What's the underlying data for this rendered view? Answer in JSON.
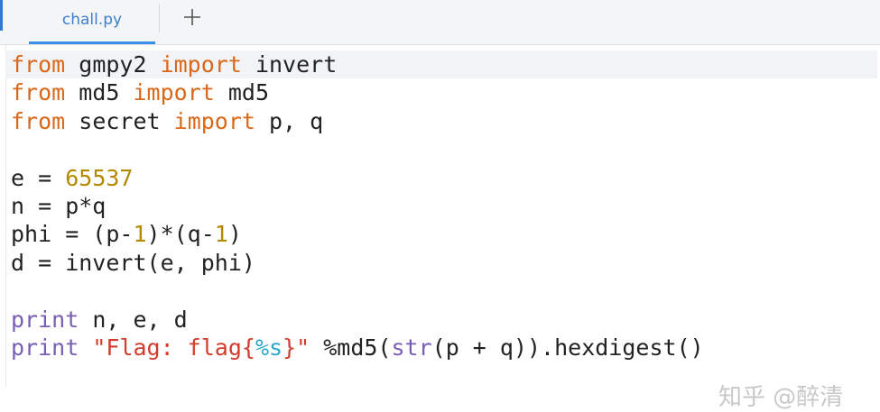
{
  "tabs": {
    "active_label": "chall.py",
    "add_symbol": "+"
  },
  "code": {
    "l1": [
      "from",
      " gmpy2 ",
      "import",
      " invert"
    ],
    "l2": [
      "from",
      " md5 ",
      "import",
      " md5"
    ],
    "l3": [
      "from",
      " secret ",
      "import",
      " p, q"
    ],
    "l5": [
      "e = ",
      "65537"
    ],
    "l6": [
      "n = p*q"
    ],
    "l7": [
      "phi = (p-",
      "1",
      ")*(q-",
      "1",
      ")"
    ],
    "l8": [
      "d = invert(e, phi)"
    ],
    "l10": [
      "print",
      " n, e, d"
    ],
    "l11": [
      "print",
      " ",
      "\"Flag: flag{",
      "%s",
      "}\"",
      " %md5(",
      "str",
      "(p + q)).hexdigest()"
    ]
  },
  "watermark": "知乎 @醉清",
  "colors": {
    "keyword": "#d9681a",
    "number": "#b38a00",
    "string": "#d33b2c",
    "format": "#2aa6c8",
    "builtin": "#7a5db5",
    "tab_accent": "#3d8ee8"
  }
}
